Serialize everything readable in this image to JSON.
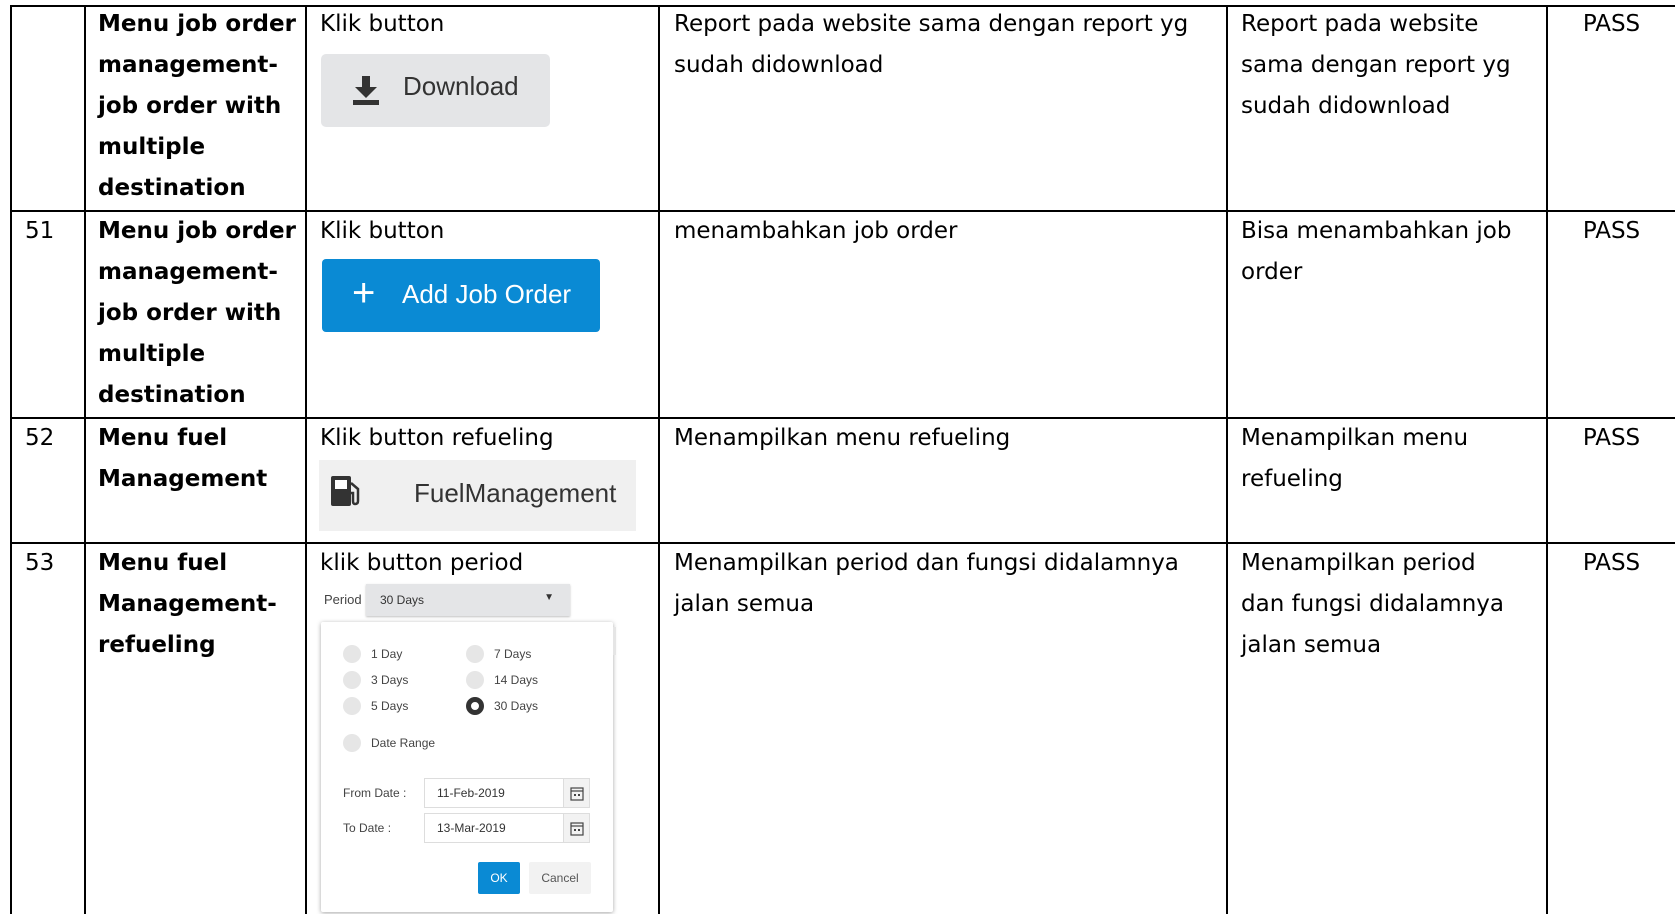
{
  "rows": [
    {
      "no": "",
      "feature": [
        "Menu job order",
        "management-",
        "job order with",
        "multiple",
        "destination"
      ],
      "step": "Klik button",
      "expected": [
        "Report pada website sama dengan report yg",
        "sudah didownload"
      ],
      "actual": [
        "Report pada website",
        "sama dengan report yg",
        "sudah didownload"
      ],
      "result": "PASS"
    },
    {
      "no": "51",
      "feature": [
        "Menu job order",
        "management-",
        "job order with",
        "multiple",
        "destination"
      ],
      "step": "Klik button",
      "expected": [
        "menambahkan job order"
      ],
      "actual": [
        "Bisa menambahkan job",
        "order"
      ],
      "result": "PASS"
    },
    {
      "no": "52",
      "feature": [
        "Menu fuel",
        "Management"
      ],
      "step": "Klik button refueling",
      "expected": [
        "Menampilkan menu refueling"
      ],
      "actual": [
        "Menampilkan menu",
        "refueling"
      ],
      "result": "PASS"
    },
    {
      "no": "53",
      "feature": [
        "Menu fuel",
        "Management-",
        "refueling"
      ],
      "step": "klik button period",
      "expected": [
        "Menampilkan period dan fungsi didalamnya",
        "jalan semua"
      ],
      "actual": [
        "Menampilkan period",
        "dan fungsi didalamnya",
        "jalan semua"
      ],
      "result": "PASS"
    }
  ],
  "download_button": {
    "label": "Download",
    "icon": "download-icon"
  },
  "add_job_button": {
    "label": "Add Job Order",
    "icon": "plus-icon",
    "color": "#0a8ad4"
  },
  "fuel_button": {
    "label": "FuelManagement",
    "icon": "fuel-pump-icon"
  },
  "period_widget": {
    "label": "Period",
    "selected": "30 Days",
    "options": [
      "1 Day",
      "7 Days",
      "3 Days",
      "14 Days",
      "5 Days",
      "30 Days"
    ],
    "date_range_label": "Date Range",
    "from_label": "From Date :",
    "from_value": "11-Feb-2019",
    "to_label": "To Date :",
    "to_value": "13-Mar-2019",
    "ok_label": "OK",
    "cancel_label": "Cancel"
  }
}
